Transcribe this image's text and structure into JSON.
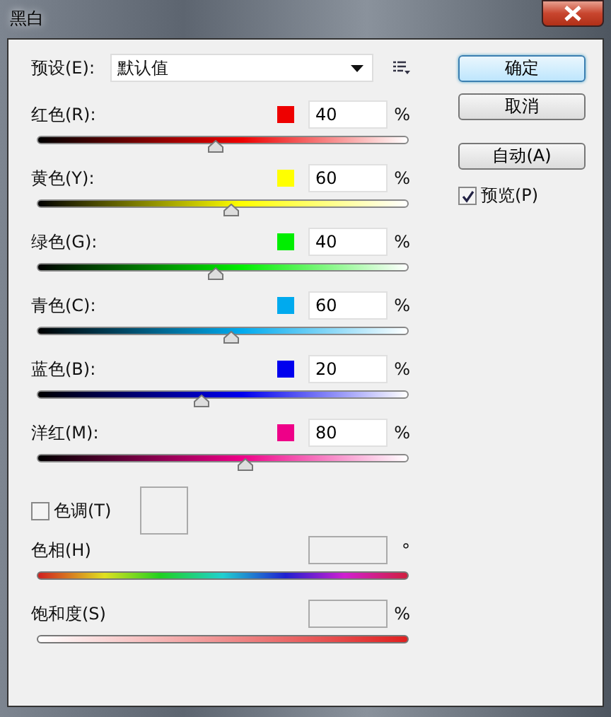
{
  "window": {
    "title": "黑白"
  },
  "preset": {
    "label": "预设(E):",
    "value": "默认值"
  },
  "channels": [
    {
      "label": "红色(R):",
      "color": "#ee0000",
      "value": "40",
      "unit": "%",
      "level": 0.48
    },
    {
      "label": "黄色(Y):",
      "color": "#ffff00",
      "value": "60",
      "unit": "%",
      "level": 0.52
    },
    {
      "label": "绿色(G):",
      "color": "#00ee00",
      "value": "40",
      "unit": "%",
      "level": 0.48
    },
    {
      "label": "青色(C):",
      "color": "#00aaee",
      "value": "60",
      "unit": "%",
      "level": 0.52
    },
    {
      "label": "蓝色(B):",
      "color": "#0000ee",
      "value": "20",
      "unit": "%",
      "level": 0.44
    },
    {
      "label": "洋红(M):",
      "color": "#ee0088",
      "value": "80",
      "unit": "%",
      "level": 0.56
    }
  ],
  "tint": {
    "label": "色调(T)",
    "checked": false
  },
  "hue": {
    "label": "色相(H)",
    "unit": "°"
  },
  "saturation": {
    "label": "饱和度(S)",
    "unit": "%"
  },
  "buttons": [
    {
      "label": "确定",
      "default": true
    },
    {
      "label": "取消",
      "default": false
    },
    {
      "label": "自动(A)",
      "default": false
    }
  ],
  "preview": {
    "label": "预览(P)",
    "checked": true
  }
}
